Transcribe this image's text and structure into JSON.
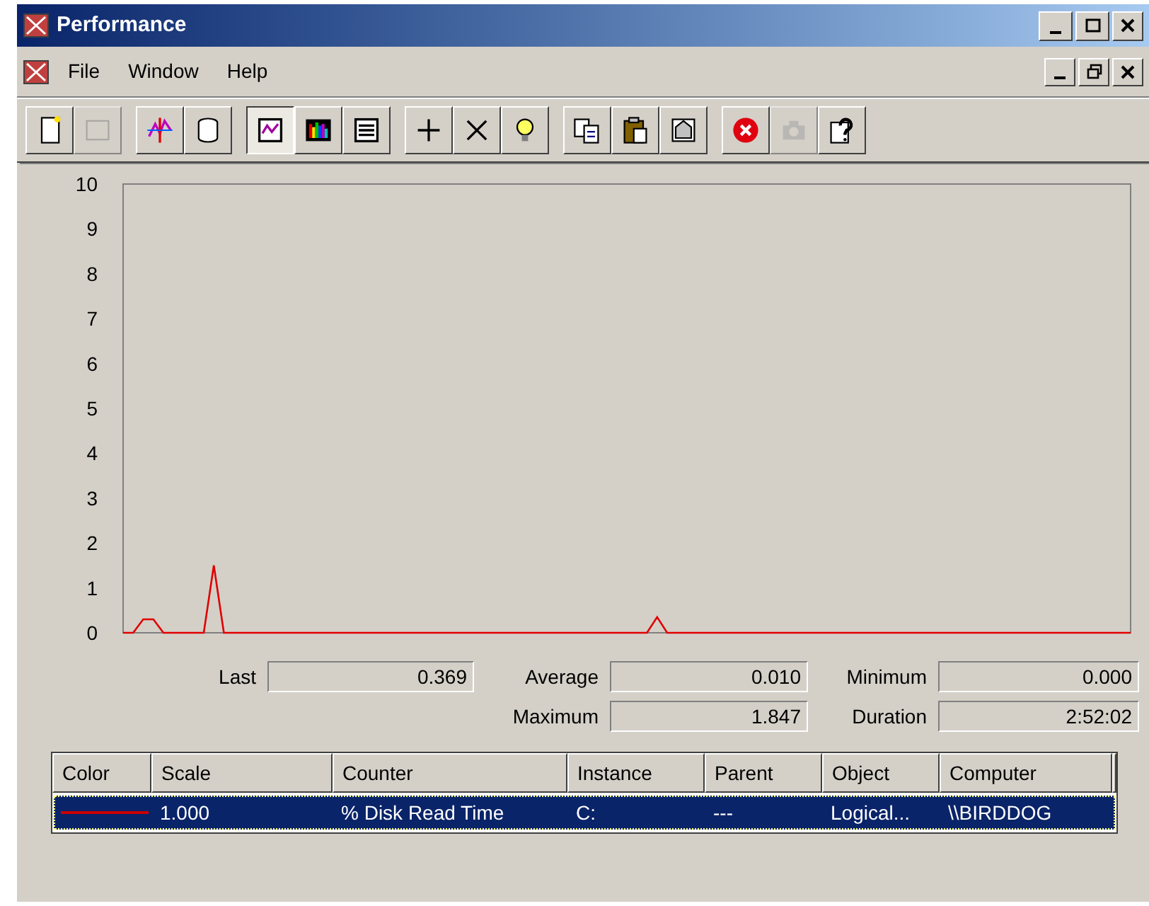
{
  "window": {
    "title": "Performance"
  },
  "menu": [
    {
      "label": "File"
    },
    {
      "label": "Window"
    },
    {
      "label": "Help"
    }
  ],
  "toolbar": [
    {
      "kind": "new",
      "selected": false,
      "disabled": false
    },
    {
      "kind": "clear",
      "selected": false,
      "disabled": true
    },
    {
      "kind": "current",
      "selected": false,
      "disabled": false
    },
    {
      "kind": "log",
      "selected": false,
      "disabled": false
    },
    {
      "kind": "graph",
      "selected": true,
      "disabled": false
    },
    {
      "kind": "histogram",
      "selected": false,
      "disabled": false
    },
    {
      "kind": "report",
      "selected": false,
      "disabled": false
    },
    {
      "kind": "add",
      "selected": false,
      "disabled": false
    },
    {
      "kind": "delete",
      "selected": false,
      "disabled": false
    },
    {
      "kind": "highlight",
      "selected": false,
      "disabled": false
    },
    {
      "kind": "copy",
      "selected": false,
      "disabled": false
    },
    {
      "kind": "paste",
      "selected": false,
      "disabled": false
    },
    {
      "kind": "properties",
      "selected": false,
      "disabled": false
    },
    {
      "kind": "freeze",
      "selected": false,
      "disabled": false
    },
    {
      "kind": "update",
      "selected": false,
      "disabled": true
    },
    {
      "kind": "help",
      "selected": false,
      "disabled": false
    }
  ],
  "chart_data": {
    "type": "line",
    "ylim": [
      0,
      10
    ],
    "yticks": [
      0,
      1,
      2,
      3,
      4,
      5,
      6,
      7,
      8,
      9,
      10
    ],
    "series": [
      {
        "color": "#e00000",
        "values": [
          0,
          0,
          0.3,
          0.3,
          0,
          0,
          0,
          0,
          0,
          1.5,
          0,
          0,
          0,
          0,
          0,
          0,
          0,
          0,
          0,
          0,
          0,
          0,
          0,
          0,
          0,
          0,
          0,
          0,
          0,
          0,
          0,
          0,
          0,
          0,
          0,
          0,
          0,
          0,
          0,
          0,
          0,
          0,
          0,
          0,
          0,
          0,
          0,
          0,
          0,
          0,
          0,
          0,
          0,
          0.35,
          0,
          0,
          0,
          0,
          0,
          0,
          0,
          0,
          0,
          0,
          0,
          0,
          0,
          0,
          0,
          0,
          0,
          0,
          0,
          0,
          0,
          0,
          0,
          0,
          0,
          0,
          0,
          0,
          0,
          0,
          0,
          0,
          0,
          0,
          0,
          0,
          0,
          0,
          0,
          0,
          0,
          0,
          0,
          0,
          0,
          0,
          0
        ]
      }
    ]
  },
  "stats": [
    {
      "label": "Last",
      "value": "0.369"
    },
    {
      "label": "Average",
      "value": "0.010"
    },
    {
      "label": "Minimum",
      "value": "0.000"
    },
    {
      "label": "Maximum",
      "value": "1.847"
    },
    {
      "label": "Duration",
      "value": "2:52:02"
    }
  ],
  "table": {
    "columns": [
      "Color",
      "Scale",
      "Counter",
      "Instance",
      "Parent",
      "Object",
      "Computer"
    ],
    "rows": [
      {
        "selected": true,
        "color": "#cc0000",
        "cells": [
          "",
          "1.000",
          "% Disk Read Time",
          "C:",
          "---",
          "Logical...",
          "\\\\BIRDDOG"
        ]
      }
    ]
  }
}
